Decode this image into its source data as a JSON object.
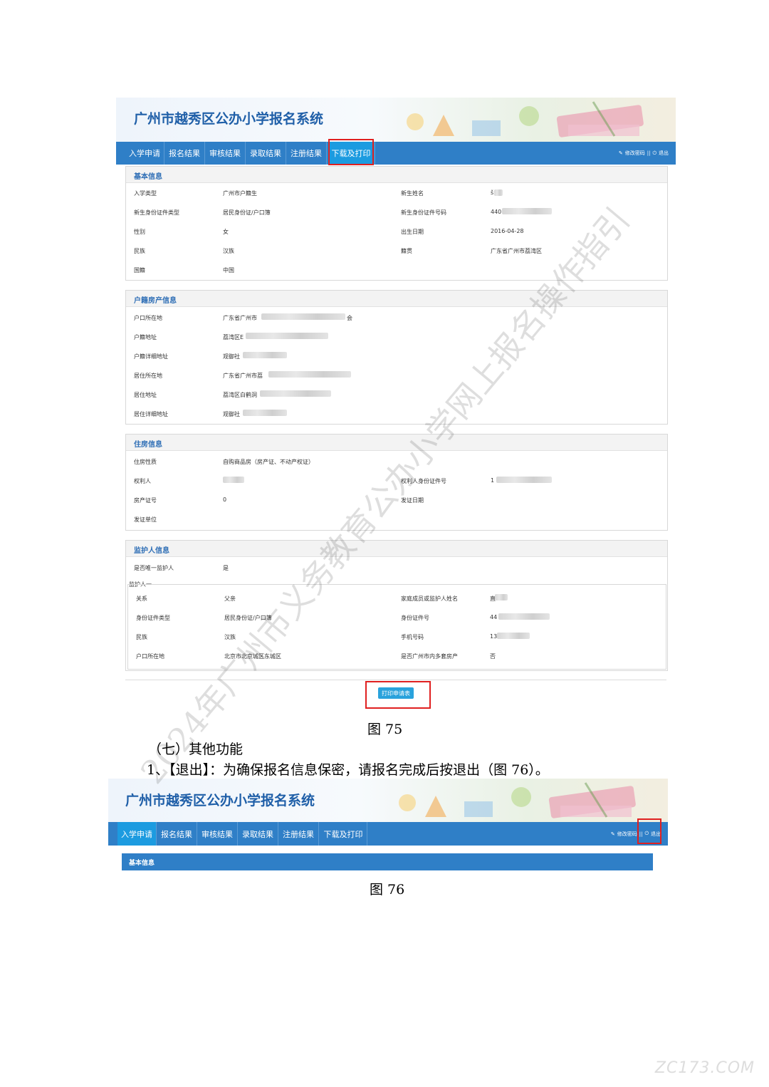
{
  "fig75": {
    "app_title": "广州市越秀区公办小学报名系统",
    "nav": [
      "入学申请",
      "报名结果",
      "审核结果",
      "录取结果",
      "注册结果",
      "下载及打印"
    ],
    "nav_active_index": 5,
    "nav_right": {
      "change_password": "修改密码",
      "separator": "||",
      "logout": "退出"
    },
    "basic": {
      "title": "基本信息",
      "rows": [
        {
          "l1": "入学类型",
          "v1": "广州市户籍生",
          "l2": "新生姓名",
          "v2": "š"
        },
        {
          "l1": "新生身份证件类型",
          "v1": "居民身份证/户口簿",
          "l2": "新生身份证件号码",
          "v2": "440"
        },
        {
          "l1": "性别",
          "v1": "女",
          "l2": "出生日期",
          "v2": "2016-04-28"
        },
        {
          "l1": "民族",
          "v1": "汉族",
          "l2": "籍贯",
          "v2": "广东省广州市荔湾区"
        },
        {
          "l1": "国籍",
          "v1": "中国",
          "l2": "",
          "v2": ""
        }
      ]
    },
    "household": {
      "title": "户籍房产信息",
      "rows": [
        {
          "l": "户口所在地",
          "v": "广东省广州市",
          "tail": "会"
        },
        {
          "l": "户籍地址",
          "v": "荔湾区E",
          "tail": ""
        },
        {
          "l": "户籍详细地址",
          "v": "观御社",
          "tail": ""
        },
        {
          "l": "居住所在地",
          "v": "广东省广州市荔",
          "tail": ""
        },
        {
          "l": "居住地址",
          "v": "荔湾区白鹤洞",
          "tail": ""
        },
        {
          "l": "居住详细地址",
          "v": "观御社",
          "tail": ""
        }
      ]
    },
    "housing": {
      "title": "住房信息",
      "rows": [
        {
          "l1": "住房性质",
          "v1": "自购商品房（房产证、不动产权证）",
          "l2": "",
          "v2": ""
        },
        {
          "l1": "权利人",
          "v1": "",
          "l2": "权利人身份证件号",
          "v2": "1"
        },
        {
          "l1": "房产证号",
          "v1": "0",
          "l2": "发证日期",
          "v2": ""
        },
        {
          "l1": "发证单位",
          "v1": "",
          "l2": "",
          "v2": ""
        }
      ]
    },
    "guardian": {
      "title": "监护人信息",
      "only_label": "是否唯一监护人",
      "only_value": "是",
      "group_label": "监护人一",
      "rows": [
        {
          "l1": "关系",
          "v1": "父亲",
          "l2": "家庭成员或监护人姓名",
          "v2": "直"
        },
        {
          "l1": "身份证件类型",
          "v1": "居民身份证/户口簿",
          "l2": "身份证件号",
          "v2": "44"
        },
        {
          "l1": "民族",
          "v1": "汉族",
          "l2": "手机号码",
          "v2": "13"
        },
        {
          "l1": "户口所在地",
          "v1": "北京市北京城区东城区",
          "l2": "是否广州市内多套房产",
          "v2": "否"
        }
      ]
    },
    "print_button": "打印申请表",
    "caption": "图 75"
  },
  "text": {
    "section": "（七）其他功能",
    "item": "1、【退出】：为确保报名信息保密，请报名完成后按退出（图 76）。"
  },
  "fig76": {
    "app_title": "广州市越秀区公办小学报名系统",
    "nav": [
      "入学申请",
      "报名结果",
      "审核结果",
      "录取结果",
      "注册结果",
      "下载及打印"
    ],
    "nav_active_index": 0,
    "nav_right": {
      "change_password": "修改密码",
      "separator": "||",
      "logout": "退出"
    },
    "panel_title": "基本信息",
    "caption": "图 76"
  },
  "watermark": "2024年广州市义务教育公办小学网上报名操作指引",
  "logo": "ZC173.COM"
}
